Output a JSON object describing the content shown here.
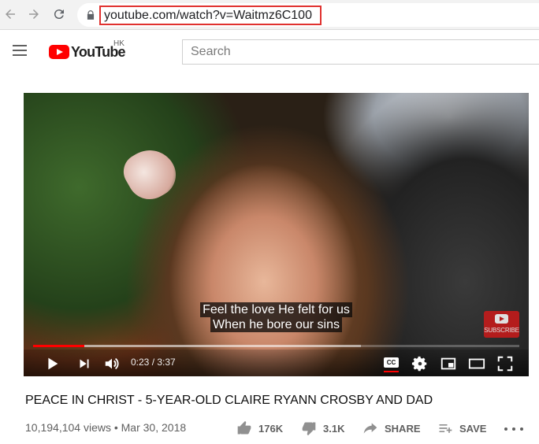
{
  "browser": {
    "url": "youtube.com/watch?v=Waitmz6C100",
    "icons": [
      "back-arrow-icon",
      "forward-arrow-icon",
      "reload-icon",
      "lock-icon"
    ]
  },
  "header": {
    "logo_text": "YouTube",
    "region": "HK",
    "search_placeholder": "Search"
  },
  "player": {
    "subtitle_lines": [
      "Feel the love He felt for us",
      "When he bore our sins"
    ],
    "subscribe_badge": "SUBSCRIBE",
    "time": "0:23 / 3:37",
    "cc_label": "CC",
    "progress_played": 0.105,
    "progress_buffered": 0.675
  },
  "video": {
    "title": "PEACE IN CHRIST - 5-YEAR-OLD CLAIRE RYANN CROSBY AND DAD",
    "meta": "10,194,104 views • Mar 30, 2018",
    "likes": "176K",
    "dislikes": "3.1K",
    "share_label": "SHARE",
    "save_label": "SAVE"
  },
  "colors": {
    "brand_red": "#ff0000",
    "url_highlight": "#e0312f"
  }
}
